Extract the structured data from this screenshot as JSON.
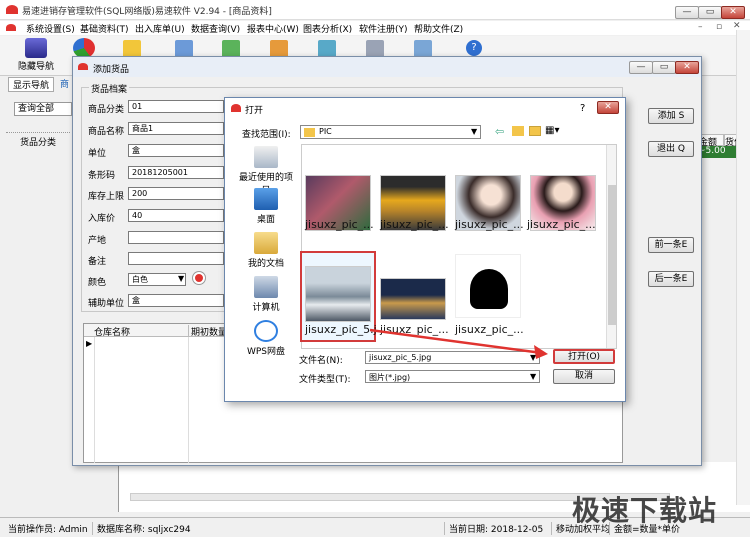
{
  "app": {
    "title": "易速进销存管理软件(SQL网络版)易速软件 V2.94 - [商品资料]",
    "menu": [
      "系统设置(S)",
      "基础资料(T)",
      "出入库单(U)",
      "数据查询(V)",
      "报表中心(W)",
      "图表分析(X)",
      "软件注册(Y)",
      "帮助文件(Z)"
    ],
    "toolbar_hide_nav": "隐藏导航",
    "toolbar_partial": "月",
    "tab_nav": "显示导航",
    "tab_partial": "商",
    "query_all": "查询全部",
    "category": "货品分类",
    "col_amount": "金额",
    "col_position": "货位",
    "cell_amount": "~5.00",
    "status_operator": "当前操作员: Admin",
    "status_db": "数据库名称: sqljxc294",
    "status_date": "当前日期: 2018-12-05",
    "status_method": "移动加权平均",
    "status_formula": "金额=数量*单价"
  },
  "goods_dialog": {
    "title": "添加货品",
    "group_title": "货品档案",
    "fields": [
      {
        "label": "商品分类",
        "value": "01"
      },
      {
        "label": "商品名称",
        "value": "商品1"
      },
      {
        "label": "单位",
        "value": "盒"
      },
      {
        "label": "条形码",
        "value": "20181205001"
      },
      {
        "label": "库存上限",
        "value": "200"
      },
      {
        "label": "入库价",
        "value": "40"
      },
      {
        "label": "产地",
        "value": ""
      },
      {
        "label": "备注",
        "value": ""
      }
    ],
    "color_label": "颜色",
    "color_value": "白色",
    "aux_unit_label": "辅助单位",
    "aux_unit_value": "盒",
    "grid_col_warehouse": "仓库名称",
    "grid_col_init_qty": "期初数量",
    "btn_add": "添加 S",
    "btn_exit": "退出 Q",
    "btn_prev": "前一条E",
    "btn_next": "后一条E"
  },
  "open_dialog": {
    "title": "打开",
    "lookin_label": "查找范围(I):",
    "lookin_value": "PIC",
    "places": [
      "最近使用的项目",
      "桌面",
      "我的文档",
      "计算机",
      "WPS网盘"
    ],
    "files": [
      "jisuxz_pic_...",
      "jisuxz_pic_...",
      "jisuxz_pic_...",
      "jisuxz_pic_...",
      "jisuxz_pic_5.j",
      "jisuxz_pic_...",
      "jisuxz_pic_..."
    ],
    "filename_label": "文件名(N):",
    "filename_value": "jisuxz_pic_5.jpg",
    "filetype_label": "文件类型(T):",
    "filetype_value": "图片(*.jpg)",
    "btn_open": "打开(O)",
    "btn_cancel": "取消"
  },
  "watermark": "极速下载站",
  "colors": {
    "accent_red": "#e0332f",
    "selection_border": "#d23b3b",
    "title_bar": "#e8eef7"
  }
}
